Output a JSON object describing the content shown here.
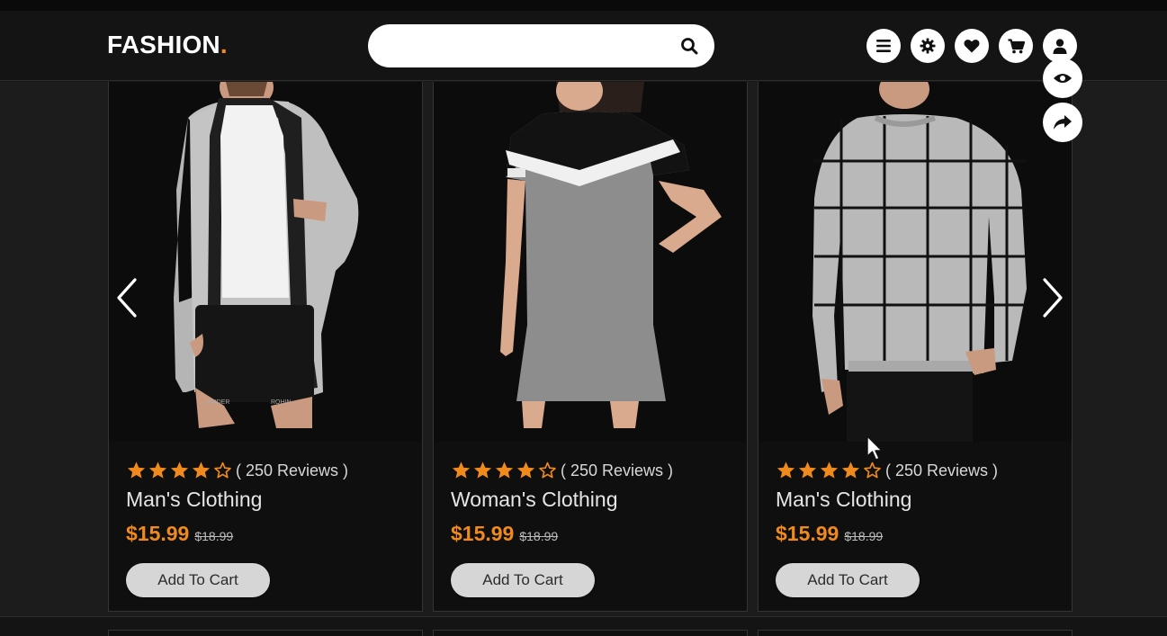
{
  "header": {
    "logo_text": "FASHION",
    "logo_dot": ".",
    "search_placeholder": "",
    "icons": [
      "menu-icon",
      "gear-icon",
      "heart-icon",
      "cart-icon",
      "user-icon"
    ]
  },
  "colors": {
    "accent": "#f08a1c",
    "background": "#181818",
    "card": "#0f0f0f",
    "button": "#d6d6d6"
  },
  "carousel": {
    "prev_icon": "chevron-left-icon",
    "next_icon": "chevron-right-icon",
    "side_icons": [
      "eye-icon",
      "share-icon"
    ]
  },
  "products": [
    {
      "rating": 4,
      "reviews": "( 250 Reviews )",
      "name": "Man's Clothing",
      "price": "$15.99",
      "old_price": "$18.99",
      "button": "Add To Cart"
    },
    {
      "rating": 4,
      "reviews": "( 250 Reviews )",
      "name": "Woman's Clothing",
      "price": "$15.99",
      "old_price": "$18.99",
      "button": "Add To Cart"
    },
    {
      "rating": 4,
      "reviews": "( 250 Reviews )",
      "name": "Man's Clothing",
      "price": "$15.99",
      "old_price": "$18.99",
      "button": "Add To Cart"
    }
  ]
}
